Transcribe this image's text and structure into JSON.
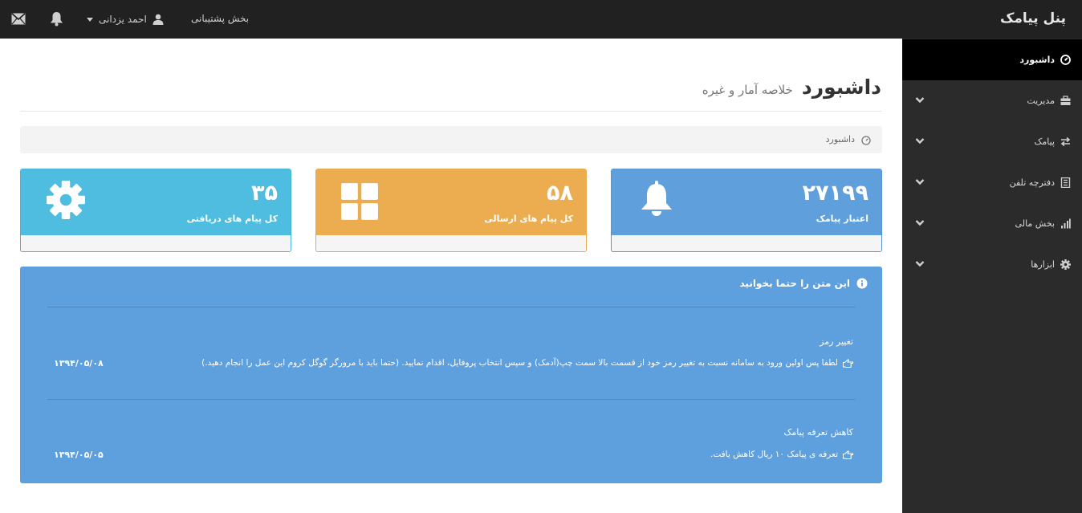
{
  "topbar": {
    "brand": "پنل پیامک",
    "support": "بخش پشتیبانی",
    "user_name": "احمد یزدانی",
    "icons": [
      "mail-icon",
      "bell-icon",
      "user-icon",
      "caret-down-icon"
    ]
  },
  "sidebar": {
    "items": [
      {
        "label": "داشبورد",
        "icon": "dashboard-icon",
        "active": true
      },
      {
        "label": "مدیریت",
        "icon": "briefcase-icon"
      },
      {
        "label": "پیامک",
        "icon": "transfer-icon"
      },
      {
        "label": "دفترچه تلفن",
        "icon": "notebook-icon"
      },
      {
        "label": "بخش مالی",
        "icon": "bar-chart-icon"
      },
      {
        "label": "ابزارها",
        "icon": "gear-icon"
      }
    ]
  },
  "page": {
    "title": "داشبورد",
    "subtitle": "خلاصه آمار و غیره",
    "breadcrumb": "داشبورد"
  },
  "stats": [
    {
      "value": "۲۷۱۹۹",
      "label": "اعتبار پیامک",
      "icon": "bell-icon",
      "color": "#5fa0dc"
    },
    {
      "value": "۵۸",
      "label": "کل پیام های ارسالی",
      "icon": "grid-icon",
      "color": "#ecad51"
    },
    {
      "value": "۳۵",
      "label": "کل پیام های دریافتی",
      "icon": "gear-icon",
      "color": "#4ebddf"
    }
  ],
  "notice": {
    "title": "این متن را حتما بخوانید",
    "items": [
      {
        "title": "تغییر رمز",
        "body": "لطفا پس اولین ورود به سامانه نسبت به تغییر رمز خود از قسمت بالا سمت چپ(آدمک) و سپس انتخاب پروفایل، اقدام نمایید. (حتما باید با مرورگر گوگل کروم این عمل را انجام دهید.)",
        "date": "۱۳۹۴/۰۵/۰۸"
      },
      {
        "title": "کاهش تعرفه پیامک",
        "body": "تعرفه ی پیامک ۱۰ ریال کاهش یافت.",
        "date": "۱۳۹۴/۰۵/۰۵"
      }
    ]
  }
}
